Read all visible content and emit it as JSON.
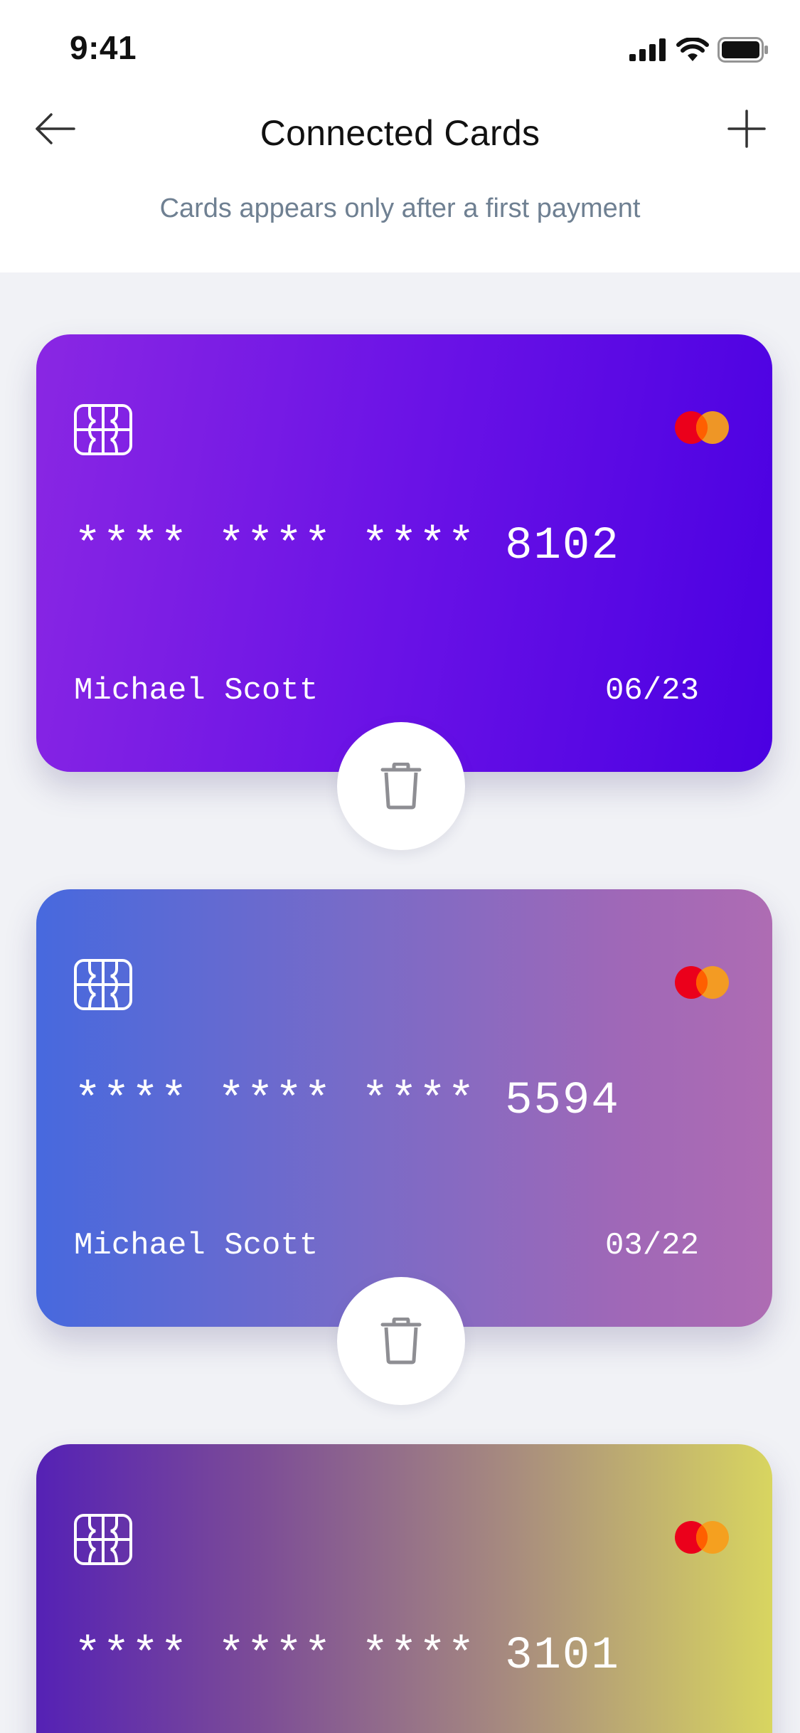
{
  "status_bar": {
    "time": "9:41"
  },
  "header": {
    "title": "Connected Cards",
    "subtitle": "Cards appears only after a first payment"
  },
  "cards": [
    {
      "number": "**** **** **** 8102",
      "holder": "Michael Scott",
      "expiry": "06/23",
      "gradient": [
        "#8A27E3",
        "#4A00E2"
      ]
    },
    {
      "number": "**** **** **** 5594",
      "holder": "Michael Scott",
      "expiry": "03/22",
      "gradient": [
        "#4769DE",
        "#AE6CB3"
      ]
    },
    {
      "number": "**** **** **** 3101",
      "holder": "",
      "expiry": "",
      "gradient": [
        "#5521B5",
        "#D8D560"
      ]
    }
  ],
  "icons": {
    "back": "arrow-left-icon",
    "add": "plus-icon",
    "chip": "card-chip-icon",
    "brand": "mastercard-logo-icon",
    "delete": "trash-icon"
  },
  "colors": {
    "brand_red": "#EB001B",
    "brand_orange": "#F79E1B",
    "subtitle": "#6F8092",
    "background": "#F1F2F6"
  }
}
